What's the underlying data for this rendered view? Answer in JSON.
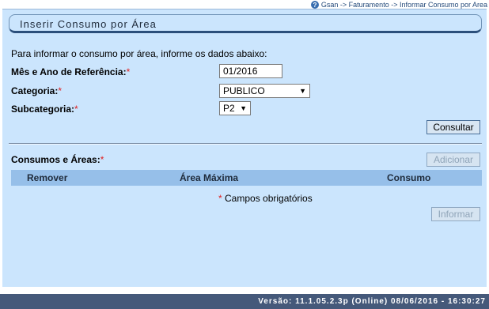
{
  "breadcrumb": {
    "text": "Gsan -> Faturamento -> Informar Consumo por Area"
  },
  "header": {
    "title": "Inserir Consumo por Área"
  },
  "form": {
    "intro": "Para informar o consumo por área, informe os dados abaixo:",
    "mes_ano_label": "Mês e Ano de Referência:",
    "mes_ano_value": "01/2016",
    "categoria_label": "Categoria:",
    "categoria_value": "PUBLICO",
    "subcategoria_label": "Subcategoria:",
    "subcategoria_value": "P2",
    "required_mark": "*",
    "consultar_label": "Consultar"
  },
  "consumos": {
    "label": "Consumos e Áreas:",
    "adicionar_label": "Adicionar",
    "columns": [
      "Remover",
      "Área Máxima",
      "Consumo"
    ],
    "rows": []
  },
  "legend": {
    "mark": "*",
    "text": "Campos obrigatórios"
  },
  "actions": {
    "informar_label": "Informar"
  },
  "footer": {
    "version": "Versão: 11.1.05.2.3p (Online) 08/06/2016 - 16:30:27"
  },
  "colors": {
    "background": "#cbe5fd",
    "header_row": "#96bfe9",
    "footer": "#45597a",
    "required": "#e02020"
  }
}
